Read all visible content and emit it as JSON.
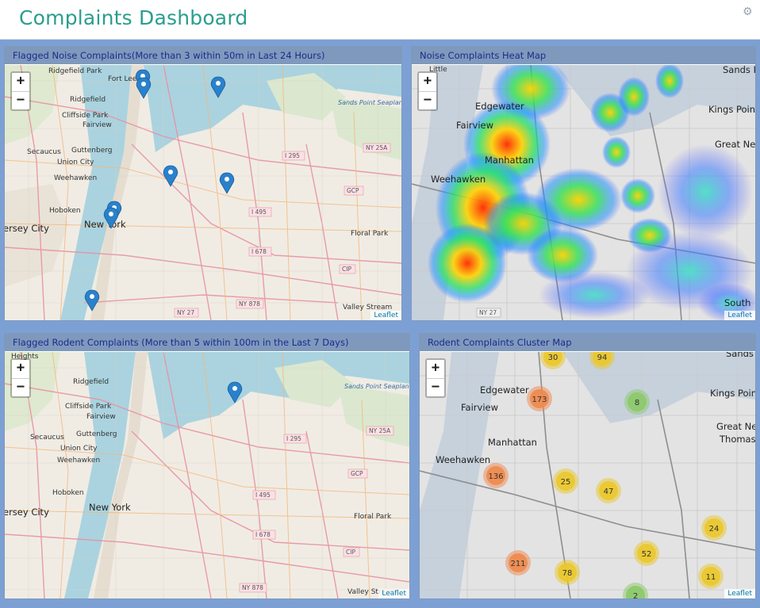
{
  "header": {
    "title": "Complaints Dashboard",
    "settings_icon": "gear-icon"
  },
  "panels": [
    {
      "title": "Flagged Noise Complaints(More than 3 within 50m in Last 24 Hours)",
      "attribution": "Leaflet",
      "zoom_in": "+",
      "zoom_out": "−"
    },
    {
      "title": "Noise Complaints Heat Map",
      "attribution": "Leaflet",
      "zoom_in": "+",
      "zoom_out": "−"
    },
    {
      "title": "Flagged Rodent Complaints (More than 5 within 100m in the Last 7 Days)",
      "attribution": "Leaflet",
      "zoom_in": "+",
      "zoom_out": "−"
    },
    {
      "title": "Rodent Complaints Cluster Map",
      "attribution": "Leaflet",
      "zoom_in": "+",
      "zoom_out": "−"
    }
  ],
  "map_labels": {
    "ridgefield_park": "Ridgefield Park",
    "fort_lee": "Fort Lee",
    "ridgefield": "Ridgefield",
    "cliffside_park": "Cliffside Park",
    "fairview": "Fairview",
    "secaucus": "Secaucus",
    "guttenberg": "Guttenberg",
    "union_city": "Union City",
    "weehawken": "Weehawken",
    "hoboken": "Hoboken",
    "jersey_city": "ersey City",
    "new_york": "New York",
    "floral_park": "Floral Park",
    "valley_stream": "Valley Stream",
    "sands_point_base": "Sands Point Seaplane Base",
    "little": "Little",
    "edgewater": "Edgewater",
    "manhattan": "Manhattan",
    "sands_point": "Sands Point",
    "kings_point": "Kings Point",
    "great_neck": "Great Neck",
    "thomaston": "Thomaston",
    "south": "South",
    "heights": "Heights"
  },
  "road_labels": [
    "I 295",
    "NY 25A",
    "I 495",
    "I 678",
    "GCP",
    "CIP",
    "NY 878",
    "NY 27"
  ],
  "cluster_markers": [
    {
      "count": "30",
      "level": "medium"
    },
    {
      "count": "94",
      "level": "medium"
    },
    {
      "count": "173",
      "level": "large"
    },
    {
      "count": "8",
      "level": "small"
    },
    {
      "count": "136",
      "level": "large"
    },
    {
      "count": "25",
      "level": "medium"
    },
    {
      "count": "47",
      "level": "medium"
    },
    {
      "count": "24",
      "level": "medium"
    },
    {
      "count": "52",
      "level": "medium"
    },
    {
      "count": "211",
      "level": "large"
    },
    {
      "count": "78",
      "level": "medium"
    },
    {
      "count": "11",
      "level": "medium"
    },
    {
      "count": "2",
      "level": "small"
    }
  ],
  "colors": {
    "accent": "#2a9d8f",
    "panel_header": "#7f99bd",
    "background": "#7da0d4",
    "cluster_small": "#8cc96a",
    "cluster_medium": "#eac82c",
    "cluster_large": "#ee8a4e"
  }
}
